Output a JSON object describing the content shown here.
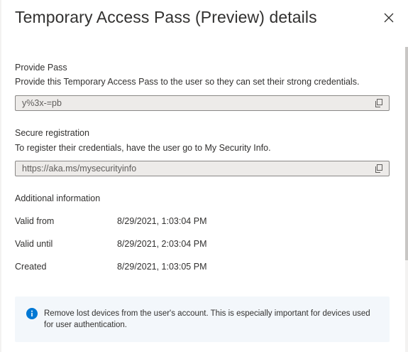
{
  "panel": {
    "title": "Temporary Access Pass (Preview) details"
  },
  "provide_pass": {
    "heading": "Provide Pass",
    "description": "Provide this Temporary Access Pass to the user so they can set their strong credentials.",
    "value": "y%3x-=pb"
  },
  "secure_registration": {
    "heading": "Secure registration",
    "description": "To register their credentials, have the user go to My Security Info.",
    "value": "https://aka.ms/mysecurityinfo"
  },
  "additional_info": {
    "heading": "Additional information",
    "rows": [
      {
        "label": "Valid from",
        "value": "8/29/2021, 1:03:04 PM"
      },
      {
        "label": "Valid until",
        "value": "8/29/2021, 2:03:04 PM"
      },
      {
        "label": "Created",
        "value": "8/29/2021, 1:03:05 PM"
      }
    ]
  },
  "info_banner": {
    "text": "Remove lost devices from the user's account. This is especially important for devices used for user authentication."
  },
  "icons": {
    "close": "close-icon",
    "copy": "copy-icon",
    "info": "info-icon"
  },
  "colors": {
    "field_bg": "#edebe9",
    "field_border": "#8a8886",
    "info_bg": "#f3f7fb",
    "info_icon": "#0078d4",
    "text": "#323130"
  }
}
